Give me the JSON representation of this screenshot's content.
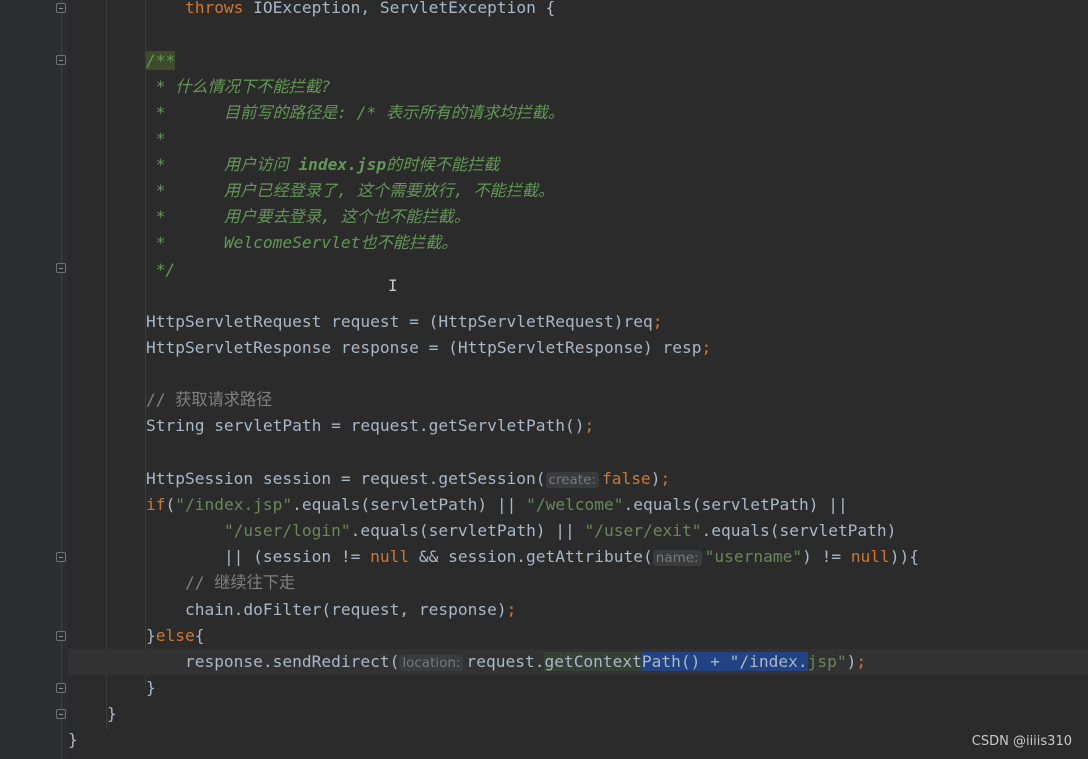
{
  "code": {
    "l0_kw": "throws",
    "l0_rest": " IOException, ServletException {",
    "doc_open": "/**",
    "doc1": " * 什么情况下不能拦截?",
    "doc2": " *      目前写的路径是: /* 表示所有的请求均拦截。",
    "doc3": " *",
    "doc4_a": " *      用户访问 ",
    "doc4_b": "index.jsp",
    "doc4_c": "的时候不能拦截",
    "doc5": " *      用户已经登录了, 这个需要放行, 不能拦截。",
    "doc6": " *      用户要去登录, 这个也不能拦截。",
    "doc7_a": " *      ",
    "doc7_b": "WelcomeServlet",
    "doc7_c": "也不能拦截。",
    "doc_close": " */",
    "req": "HttpServletRequest request = (HttpServletRequest)req",
    "resp": "HttpServletResponse response = (HttpServletResponse) resp",
    "semi": ";",
    "cmt_path": "// 获取请求路径",
    "path_decl": "String servletPath = request.getServletPath()",
    "sess_a": "HttpSession session = request.getSession(",
    "hint_create": "create:",
    "kw_false": "false",
    "sess_close": ")",
    "if_kw": "if",
    "paren_open": "(",
    "s_index": "\"/index.jsp\"",
    "eq_sp_1": ".equals(servletPath) || ",
    "s_welcome": "\"/welcome\"",
    "eq_sp_2": ".equals(servletPath) ||",
    "indent_cont": "        ",
    "s_login": "\"/user/login\"",
    "eq_sp_3": ".equals(servletPath) || ",
    "s_exit": "\"/user/exit\"",
    "eq_sp_4": ".equals(servletPath)",
    "or_sess": "|| (session != ",
    "kw_null": "null",
    "and_get": " && session.getAttribute(",
    "hint_name": "name:",
    "s_username": "\"username\"",
    "neq": ") != ",
    "close_brace": ")){",
    "cmt_continue": "// 继续往下走",
    "chain": "chain.doFilter(request, response)",
    "else_a": "}",
    "else_kw": "else",
    "else_b": "{",
    "redirect_a": "response.sendRedirect(",
    "hint_location": "location:",
    "redirect_b": "request.",
    "redirect_hl": "getContext",
    "redirect_sel": "Path() + \"/index.",
    "redirect_c": "jsp\"",
    "redirect_d": ")",
    "brace": "}"
  },
  "watermark": "CSDN @iiiis310"
}
